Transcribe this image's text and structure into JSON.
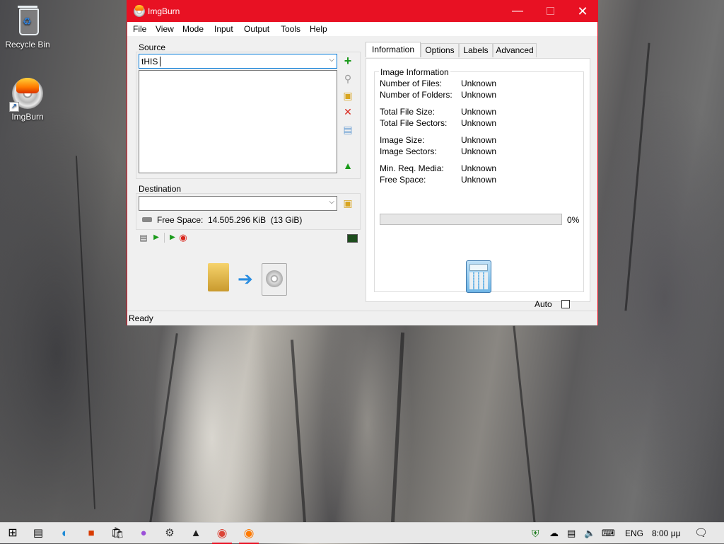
{
  "desktop": {
    "icons": [
      {
        "label": "Recycle Bin",
        "icon": "recycle-bin-icon"
      },
      {
        "label": "ImgBurn",
        "icon": "imgburn-icon"
      }
    ]
  },
  "window": {
    "title": "ImgBurn",
    "controls": {
      "minimize": "—",
      "maximize": "□",
      "close": "✕"
    }
  },
  "menu": {
    "items": [
      "File",
      "View",
      "Mode",
      "Input",
      "Output",
      "Tools",
      "Help"
    ]
  },
  "source": {
    "label": "Source",
    "value": "tHIS",
    "tool_icons": [
      "add-icon",
      "search-icon",
      "browse-folder-icon",
      "delete-icon",
      "clear-icon",
      "calculate-icon"
    ]
  },
  "destination": {
    "label": "Destination",
    "value": "",
    "free_space_label": "Free Space:",
    "free_space_value": "14.505.296 KiB  (13 GiB)"
  },
  "tabs": [
    "Information",
    "Options",
    "Labels",
    "Advanced"
  ],
  "info": {
    "group_title": "Image Information",
    "rows": [
      {
        "label": "Number of Files:",
        "value": "Unknown"
      },
      {
        "label": "Number of Folders:",
        "value": "Unknown"
      },
      {
        "label": "Total File Size:",
        "value": "Unknown"
      },
      {
        "label": "Total File Sectors:",
        "value": "Unknown"
      },
      {
        "label": "Image Size:",
        "value": "Unknown"
      },
      {
        "label": "Image Sectors:",
        "value": "Unknown"
      },
      {
        "label": "Min. Req. Media:",
        "value": "Unknown"
      },
      {
        "label": "Free Space:",
        "value": "Unknown"
      }
    ],
    "progress_percent": 0,
    "progress_label": "0%",
    "auto_label": "Auto",
    "auto_checked": false
  },
  "status": {
    "text": "Ready"
  },
  "taskbar": {
    "items": [
      "windows-start-icon",
      "task-view-icon",
      "edge-icon",
      "office-icon",
      "store-icon",
      "paint-icon",
      "settings-icon",
      "photos-icon",
      "chrome-icon",
      "imgburn-icon"
    ],
    "language": "ENG",
    "time": "8:00 μμ"
  },
  "colors": {
    "accent": "#e81123",
    "taskbar_bg": "#e8e8e8",
    "window_bg": "#f0f0f0"
  }
}
